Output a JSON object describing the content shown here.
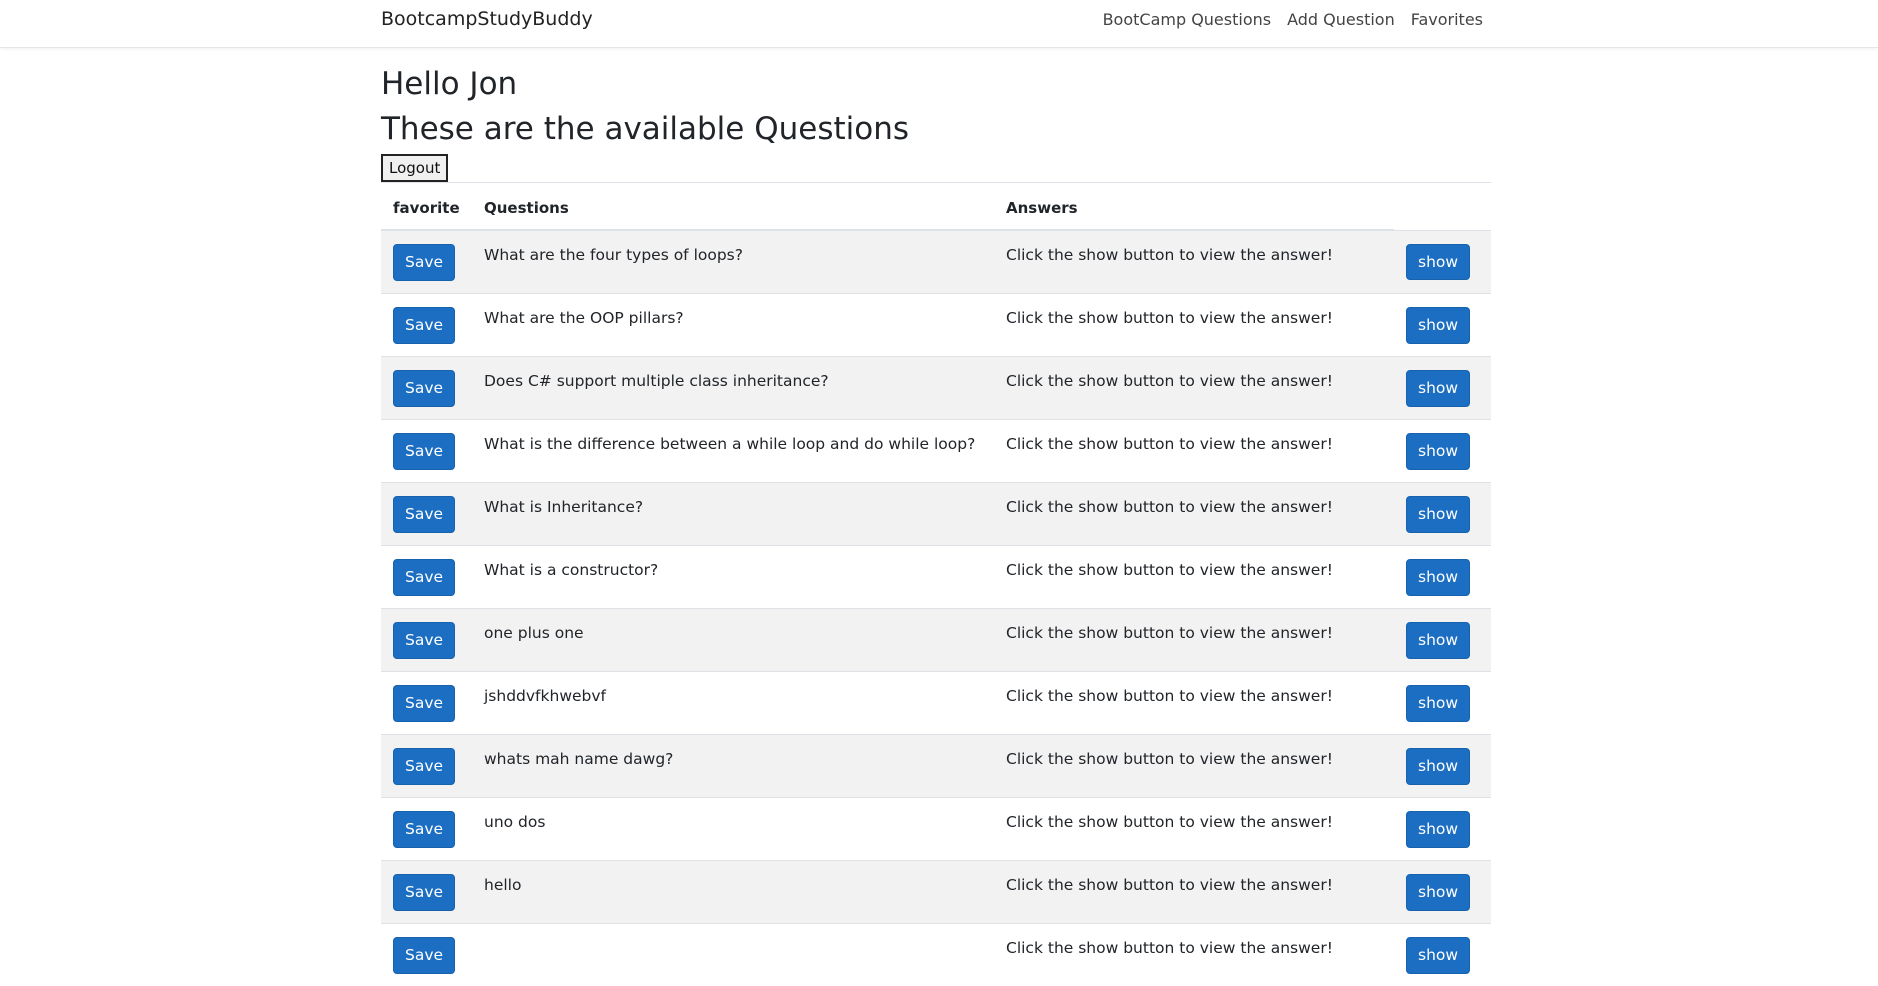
{
  "navbar": {
    "brand": "BootcampStudyBuddy",
    "links": [
      "BootCamp Questions",
      "Add Question",
      "Favorites"
    ]
  },
  "greeting": "Hello Jon",
  "subtitle": "These are the available Questions",
  "logout_label": "Logout",
  "table": {
    "headers": {
      "favorite": "favorite",
      "questions": "Questions",
      "answers": "Answers"
    },
    "save_label": "Save",
    "show_label": "show",
    "answer_placeholder": "Click the show button to view the answer!",
    "rows": [
      "What are the four types of loops?",
      "What are the OOP pillars?",
      "Does C# support multiple class inheritance?",
      "What is the difference between a while loop and do while loop?",
      "What is Inheritance?",
      "What is a constructor?",
      "one plus one",
      "jshddvfkhwebvf",
      "whats mah name dawg?",
      "uno dos",
      "hello",
      ""
    ]
  },
  "colors": {
    "primary": "#1b6ec2",
    "stripe": "#f2f2f2"
  }
}
